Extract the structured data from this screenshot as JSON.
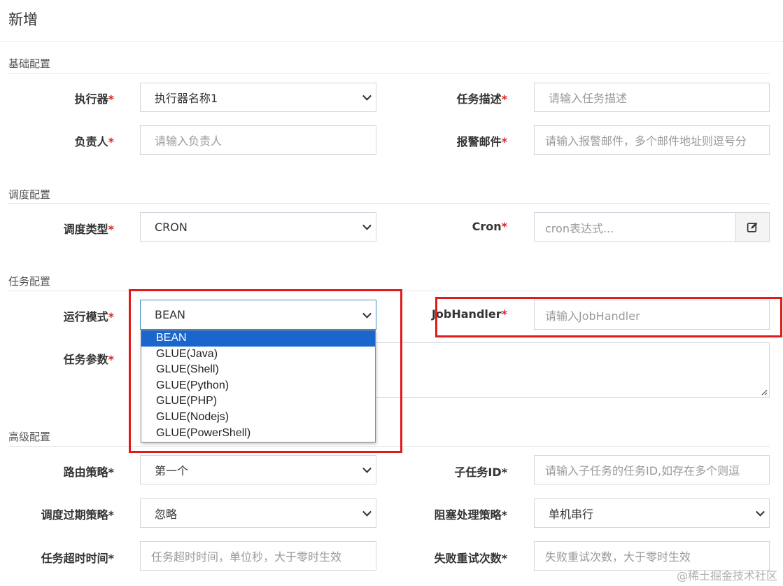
{
  "modal": {
    "title": "新增"
  },
  "sections": {
    "basic": "基础配置",
    "schedule": "调度配置",
    "task": "任务配置",
    "advanced": "高级配置"
  },
  "fields": {
    "executor": {
      "label": "执行器",
      "req": "*",
      "value": "执行器名称1"
    },
    "jobDesc": {
      "label": "任务描述",
      "req": "*",
      "placeholder": "请输入任务描述"
    },
    "author": {
      "label": "负责人",
      "req": "*",
      "placeholder": "请输入负责人"
    },
    "alarmEmail": {
      "label": "报警邮件",
      "req": "*",
      "placeholder": "请输入报警邮件，多个邮件地址则逗号分"
    },
    "scheduleType": {
      "label": "调度类型",
      "req": "*",
      "value": "CRON"
    },
    "cron": {
      "label": "Cron",
      "req": "*",
      "placeholder": "cron表达式..."
    },
    "glueType": {
      "label": "运行模式",
      "req": "*",
      "value": "BEAN"
    },
    "jobHandler": {
      "label": "JobHandler",
      "req": "*",
      "placeholder": "请输入JobHandler"
    },
    "jobParam": {
      "label": "任务参数",
      "req": "*"
    },
    "routeStrategy": {
      "label": "路由策略",
      "req": "*",
      "value": "第一个"
    },
    "childJobId": {
      "label": "子任务ID",
      "req": "*",
      "placeholder": "请输入子任务的任务ID,如存在多个则逗"
    },
    "misfireStrategy": {
      "label": "调度过期策略",
      "req": "*",
      "value": "忽略"
    },
    "blockStrategy": {
      "label": "阻塞处理策略",
      "req": "*",
      "value": "单机串行"
    },
    "timeout": {
      "label": "任务超时时间",
      "req": "*",
      "placeholder": "任务超时时间，单位秒，大于零时生效"
    },
    "failRetry": {
      "label": "失败重试次数",
      "req": "*",
      "placeholder": "失败重试次数，大于零时生效"
    }
  },
  "glueOptions": [
    "BEAN",
    "GLUE(Java)",
    "GLUE(Shell)",
    "GLUE(Python)",
    "GLUE(PHP)",
    "GLUE(Nodejs)",
    "GLUE(PowerShell)"
  ],
  "icons": {
    "cronButton": "edit-icon",
    "selectArrow": "chevron-down-icon"
  },
  "colors": {
    "required": "#dd2222",
    "selectedOption": "#1a66cc",
    "highlight": "#e11a1a"
  },
  "watermark": "@稀土掘金技术社区"
}
